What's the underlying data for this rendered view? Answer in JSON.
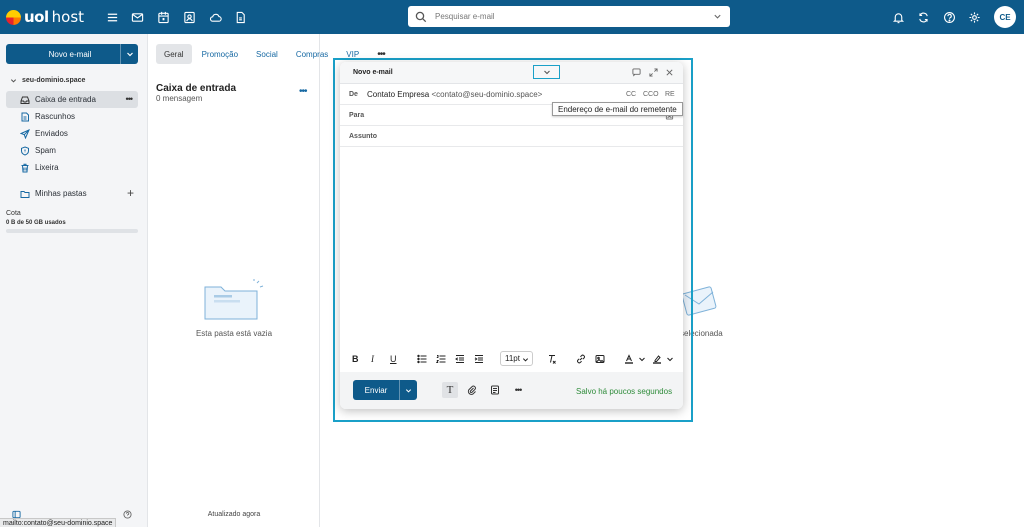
{
  "brand": {
    "logo_text": "uol",
    "logo_sub": "host"
  },
  "search": {
    "placeholder": "Pesquisar e-mail"
  },
  "user": {
    "initials": "CE"
  },
  "sidebar": {
    "new_mail_label": "Novo e-mail",
    "account": "seu-dominio.space",
    "folders": [
      {
        "label": "Caixa de entrada",
        "icon": "inbox-icon",
        "active": true
      },
      {
        "label": "Rascunhos",
        "icon": "draft-icon"
      },
      {
        "label": "Enviados",
        "icon": "send-icon"
      },
      {
        "label": "Spam",
        "icon": "spam-icon"
      },
      {
        "label": "Lixeira",
        "icon": "trash-icon"
      }
    ],
    "my_folders_label": "Minhas pastas",
    "quota_label": "Cota",
    "quota_value": "0 B de 50 GB usados",
    "quota_used_fraction": 0
  },
  "list": {
    "tabs": [
      "Geral",
      "Promoção",
      "Social",
      "Compras",
      "VIP"
    ],
    "title": "Caixa de entrada",
    "count": "0 mensagem",
    "empty_text": "Esta pasta está vazia",
    "updated": "Atualizado agora"
  },
  "reading": {
    "empty_text_visible": "selecionada"
  },
  "compose": {
    "title": "Novo e-mail",
    "from_label": "De",
    "from_name": "Contato Empresa",
    "from_addr": "<contato@seu-dominio.space>",
    "cc": "CC",
    "cco": "CCO",
    "re": "RE",
    "to_label": "Para",
    "subject_label": "Assunto",
    "tooltip": "Endereço de e-mail do remetente",
    "font_size": "11pt",
    "send_label": "Enviar",
    "saved_text": "Salvo há poucos segundos"
  },
  "statusbar": {
    "text": "mailto:contato@seu-dominio.space"
  },
  "colors": {
    "brand": "#0e5a8a",
    "focus": "#1aa0c8",
    "saved": "#2e8b3a"
  }
}
